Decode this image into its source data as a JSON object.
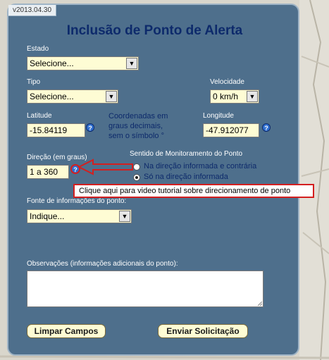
{
  "version": "v2013.04.30",
  "title": "Inclusão de Ponto de Alerta",
  "estado": {
    "label": "Estado",
    "value": "Selecione..."
  },
  "tipo": {
    "label": "Tipo",
    "value": "Selecione..."
  },
  "velocidade": {
    "label": "Velocidade",
    "value": "0 km/h"
  },
  "latitude": {
    "label": "Latitude",
    "value": "-15.84119"
  },
  "coord_note": [
    "Coordenadas em",
    "graus decimais,",
    "sem o símbolo °"
  ],
  "longitude": {
    "label": "Longitude",
    "value": "-47.912077"
  },
  "direcao": {
    "label": "Direção (em graus)",
    "value": "1 a 360"
  },
  "sentido": {
    "label": "Sentido de Monitoramento do Ponto",
    "options": [
      "Na direção informada e contrária",
      "Só na direção informada"
    ],
    "selected": 1
  },
  "tooltip": "Clique aqui para video tutorial sobre direcionamento de ponto",
  "fonte": {
    "label": "Fonte de informações do ponto:",
    "value": "Indique..."
  },
  "observacoes": {
    "label": "Observações (informações adicionais do ponto):",
    "value": ""
  },
  "buttons": {
    "clear": "Limpar Campos",
    "submit": "Enviar Solicitação"
  },
  "help_glyph": "?",
  "arrow_glyph": "▼",
  "colors": {
    "panel": "#4e6f8c",
    "title": "#0d2a6b",
    "field": "#fefcd4",
    "highlight": "#d41f1f"
  }
}
